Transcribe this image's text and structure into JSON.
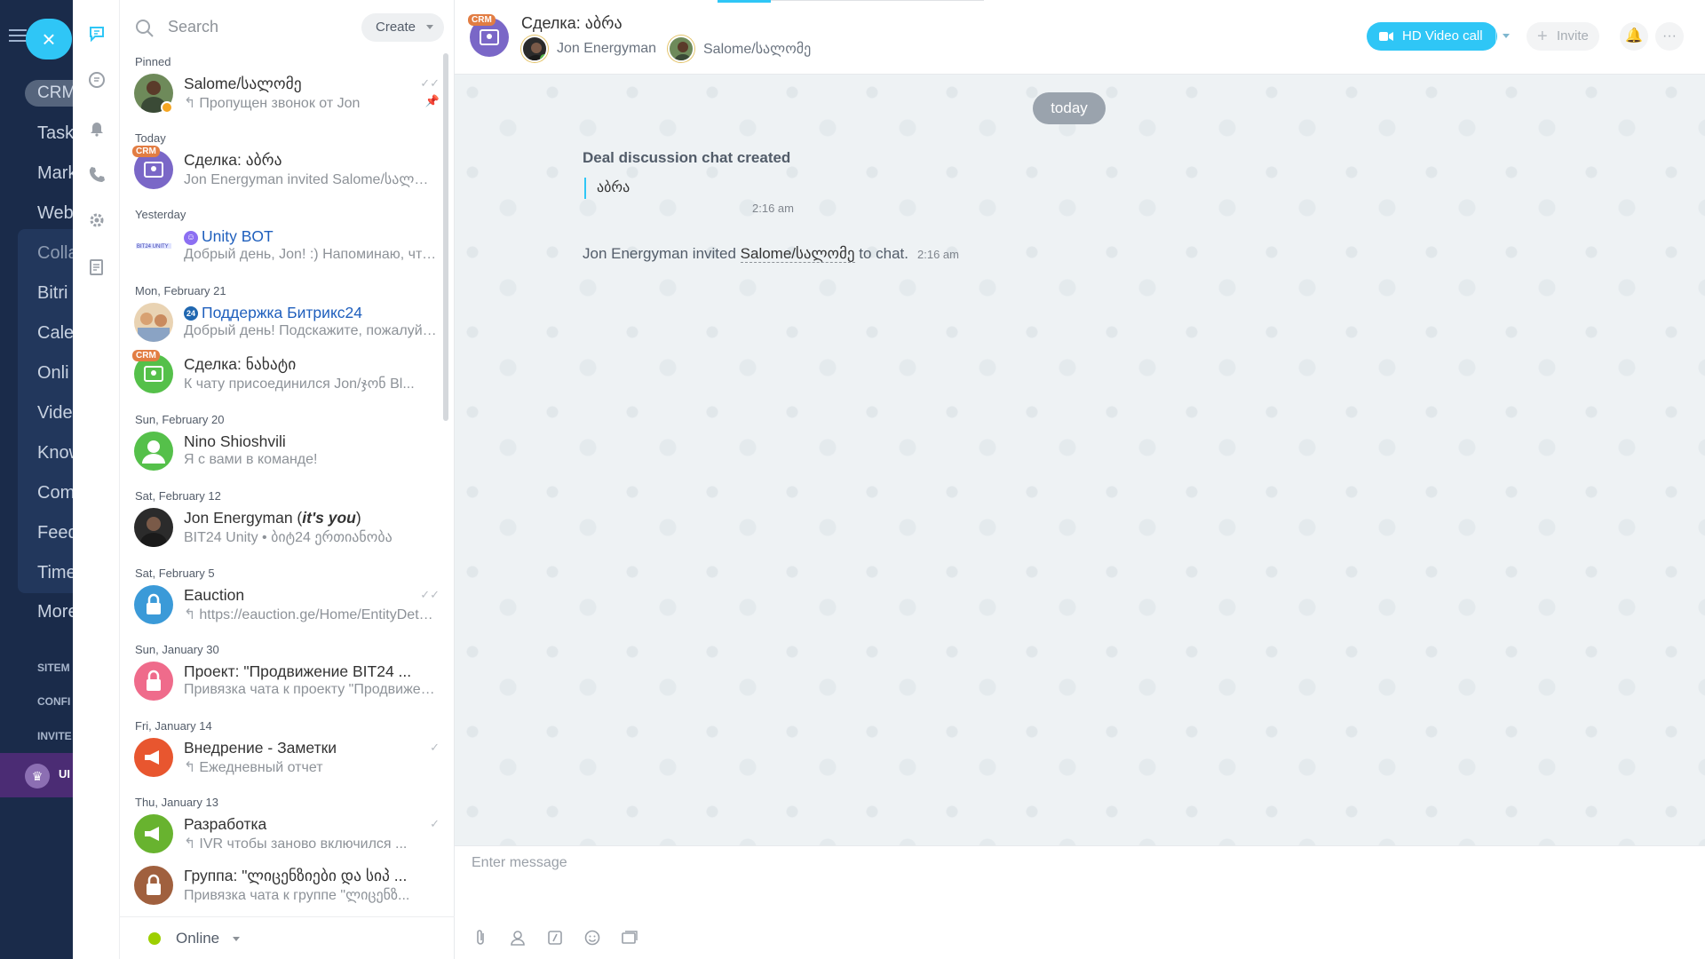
{
  "portal_nav": {
    "crm_label": "CRM",
    "items": [
      "Task",
      "Mark",
      "Web",
      "Colla",
      "Bitri",
      "Cale",
      "Onli",
      "Vide",
      "Know",
      "Com",
      "Feed",
      "Time",
      "More"
    ],
    "caps": [
      "SITEM",
      "CONFI",
      "INVITE"
    ],
    "upgrade_label": "UI"
  },
  "close_button": "×",
  "rail_icons": [
    "chat-icon",
    "notifications-list-icon",
    "bell-icon",
    "phone-icon",
    "settings-gear-icon",
    "notes-icon"
  ],
  "search": {
    "placeholder": "Search",
    "create_label": "Create"
  },
  "groups": {
    "pinned": "Pinned",
    "today": "Today",
    "yesterday": "Yesterday",
    "feb21": "Mon, February 21",
    "feb20": "Sun, February 20",
    "feb12": "Sat, February 12",
    "feb5": "Sat, February 5",
    "jan30": "Sun, January 30",
    "jan14": "Fri, January 14",
    "jan13": "Thu, January 13"
  },
  "chats": [
    {
      "title": "Salome/სალომე",
      "sub": "Пропущен звонок от Jon"
    },
    {
      "title": "Сделка: აბრა",
      "sub": "Jon Energyman invited Salome/სალომე to chat."
    },
    {
      "title": "Unity BOT",
      "sub": "Добрый день, Jon! :) Напоминаю, что..."
    },
    {
      "title": "Поддержка Битрикс24",
      "sub": "Добрый день! Подскажите, пожалуйста..."
    },
    {
      "title": "Сделка: ნახატი",
      "sub": "К чату присоединился Jon/ჯონ Bl..."
    },
    {
      "title": "Nino Shioshvili",
      "sub": "Я с вами в команде!"
    },
    {
      "title_pre": "Jon Energyman (",
      "title_em": "it's you",
      "title_post": ")",
      "sub": "BIT24 Unity • ბიტ24 ერთიანობა"
    },
    {
      "title": "Eauction",
      "sub": "https://eauction.ge/Home/EntityDetails"
    },
    {
      "title": "Проект: \"Продвижение BIT24 ...",
      "sub": "Привязка чата к проекту \"Продвижение..."
    },
    {
      "title": "Внедрение - Заметки",
      "sub": "Ежедневный отчет"
    },
    {
      "title": "Разработка",
      "sub": "IVR чтобы заново включился ..."
    },
    {
      "title": "Группа: \"ლიცენზიები და სიპ ...",
      "sub": "Привязка чата к группе \"ლიცენზ..."
    }
  ],
  "badges": {
    "crm": "CRM",
    "bot": "☺",
    "b24": "24"
  },
  "status": {
    "label": "Online",
    "color": "#9dcf00"
  },
  "header": {
    "title": "Сделка: აბრა",
    "members": [
      "Jon Energyman",
      "Salome/სალომე"
    ],
    "video_label": "HD Video call",
    "invite_label": "Invite",
    "bell": "🔔",
    "more": "···"
  },
  "messages": {
    "date": "today",
    "system_title": "Deal discussion chat created",
    "quote": "აბრა",
    "system_time": "2:16 am",
    "invite_pre": "Jon Energyman invited ",
    "invite_link": "Salome/სალომე",
    "invite_post": " to chat.",
    "invite_time": "2:16 am"
  },
  "composer": {
    "placeholder": "Enter message"
  },
  "colors": {
    "accent": "#2fc6f6",
    "nav": "#1a2b4a",
    "online": "#9dcf00"
  }
}
